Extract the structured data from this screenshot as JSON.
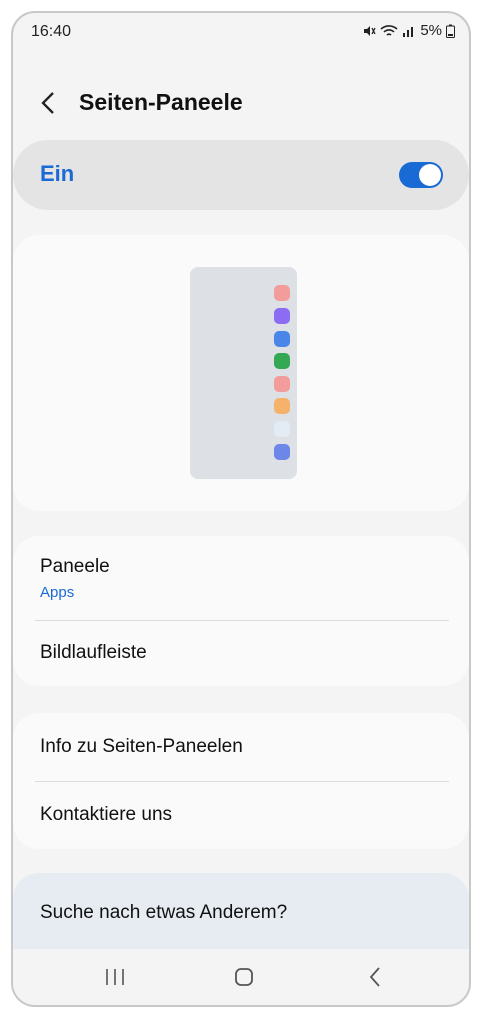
{
  "status_bar": {
    "time": "16:40",
    "battery": "5%"
  },
  "header": {
    "title": "Seiten-Paneele"
  },
  "master_toggle": {
    "label": "Ein",
    "state": "on"
  },
  "preview": {
    "app_colors": [
      "#f29c9c",
      "#8b6cf2",
      "#4a86e8",
      "#34a853",
      "#f29c9c",
      "#f6b26b",
      "#e3ecf5",
      "#6d87e8"
    ]
  },
  "menu1": {
    "panels_label": "Paneele",
    "panels_sub": "Apps",
    "scrollbar_label": "Bildlaufleiste"
  },
  "menu2": {
    "info_label": "Info zu Seiten-Paneelen",
    "contact_label": "Kontaktiere uns"
  },
  "search": {
    "label": "Suche nach etwas Anderem?"
  },
  "colors": {
    "accent": "#1a6ad6"
  }
}
